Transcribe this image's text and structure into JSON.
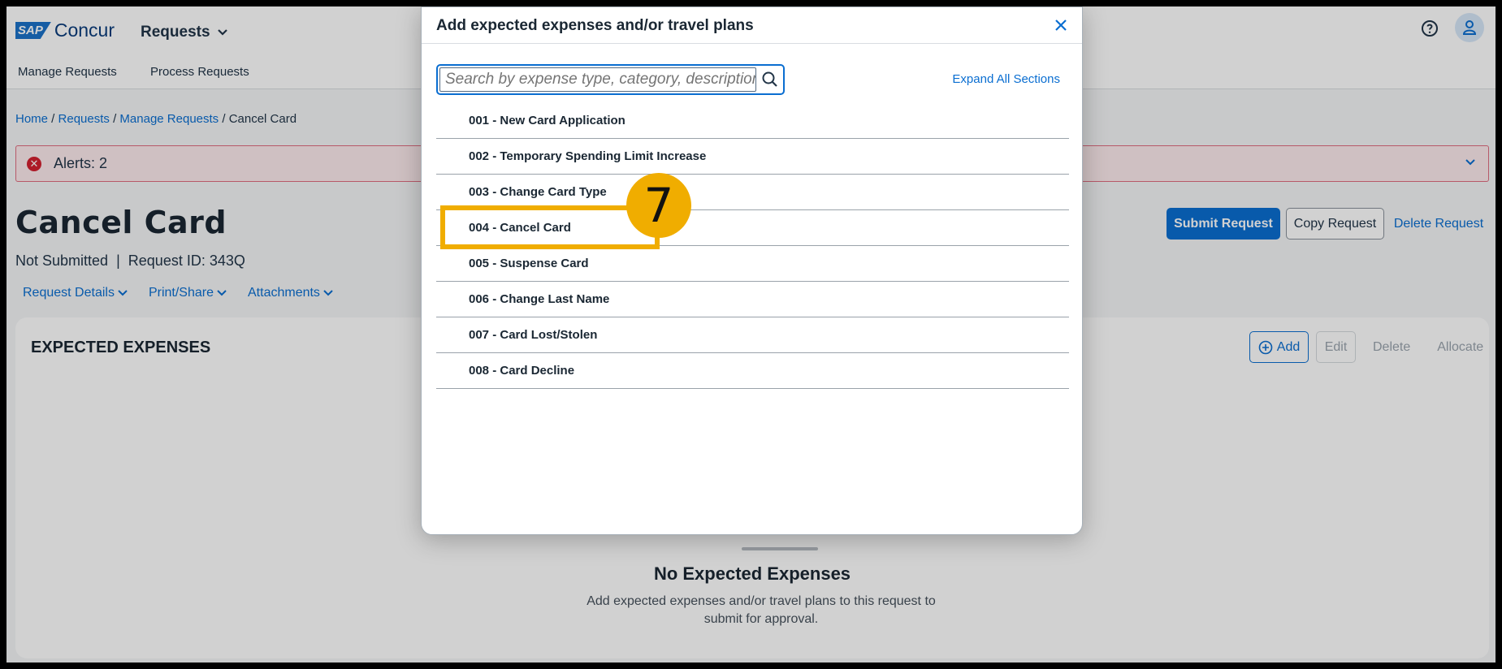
{
  "header": {
    "logo_sap": "SAP",
    "logo_concur": "Concur",
    "app_menu": "Requests",
    "icons": {
      "help": "help-circle-icon",
      "avatar": "user-icon",
      "app_menu_chevron": "chevron-down-icon"
    }
  },
  "subnav": {
    "items": [
      "Manage Requests",
      "Process Requests"
    ]
  },
  "breadcrumb": {
    "items": [
      "Home",
      "Requests",
      "Manage Requests"
    ],
    "current": "Cancel Card"
  },
  "alerts": {
    "label": "Alerts: 2"
  },
  "page": {
    "title": "Cancel Card",
    "status": "Not Submitted",
    "separator": "|",
    "request_id": "Request ID: 343Q",
    "actions": {
      "submit": "Submit Request",
      "copy": "Copy Request",
      "delete": "Delete Request"
    },
    "tabs": [
      "Request Details",
      "Print/Share",
      "Attachments"
    ]
  },
  "expenses": {
    "title": "EXPECTED EXPENSES",
    "toolbar": {
      "add": "Add",
      "edit": "Edit",
      "delete": "Delete",
      "allocate": "Allocate"
    },
    "empty_title": "No Expected Expenses",
    "empty_desc": "Add expected expenses and/or travel plans to this request to submit for approval."
  },
  "modal": {
    "title": "Add expected expenses and/or travel plans",
    "search_placeholder": "Search by expense type, category, description",
    "expand_all": "Expand All Sections",
    "items": [
      "001 - New Card Application",
      "002 - Temporary Spending Limit Increase",
      "003 - Change Card Type",
      "004 - Cancel Card",
      "005 - Suspense Card",
      "006 - Change Last Name",
      "007 - Card Lost/Stolen",
      "008 - Card Decline"
    ]
  },
  "callout": {
    "step": "7"
  },
  "colors": {
    "accent": "#0a6ed1",
    "highlight": "#f0ad00",
    "alert_bg": "#fdebed",
    "error": "#d32030"
  }
}
